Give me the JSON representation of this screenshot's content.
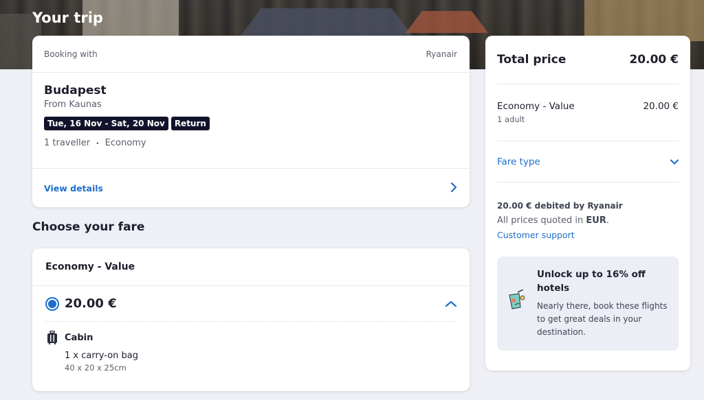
{
  "page": {
    "title": "Your trip"
  },
  "trip": {
    "booking_with_label": "Booking with",
    "airline": "Ryanair",
    "destination": "Budapest",
    "origin": "From Kaunas",
    "dates": "Tue, 16 Nov - Sat, 20 Nov",
    "trip_type": "Return",
    "travellers": "1 traveller",
    "separator": "•",
    "cabin_class": "Economy",
    "view_details": "View details"
  },
  "fares": {
    "section_title": "Choose your fare",
    "fare_name": "Economy - Value",
    "price": "20.00 €",
    "selected": true,
    "cabin": {
      "title": "Cabin",
      "item": "1 x carry-on bag",
      "dimensions": "40 x 20 x 25cm"
    }
  },
  "summary": {
    "total_label": "Total price",
    "total_value": "20.00 €",
    "line_label": "Economy - Value",
    "line_sub": "1 adult",
    "line_price": "20.00 €",
    "fare_type_label": "Fare type",
    "debit_text": "20.00 € debited by Ryanair",
    "quoted_prefix": "All prices quoted in ",
    "quoted_currency": "EUR",
    "quoted_suffix": ".",
    "support_link": "Customer support",
    "promo": {
      "title": "Unlock up to 16% off hotels",
      "text": "Nearly there, book these flights to get great deals in your destination."
    }
  },
  "icons": {
    "chevron_right": "chevron-right-icon",
    "chevron_up": "chevron-up-icon",
    "chevron_down": "chevron-down-icon",
    "luggage": "luggage-icon",
    "cocktail": "cocktail-icon"
  },
  "colors": {
    "accent": "#1c6fcd",
    "tag_bg": "#12132b",
    "page_bg": "#eef0f5"
  }
}
